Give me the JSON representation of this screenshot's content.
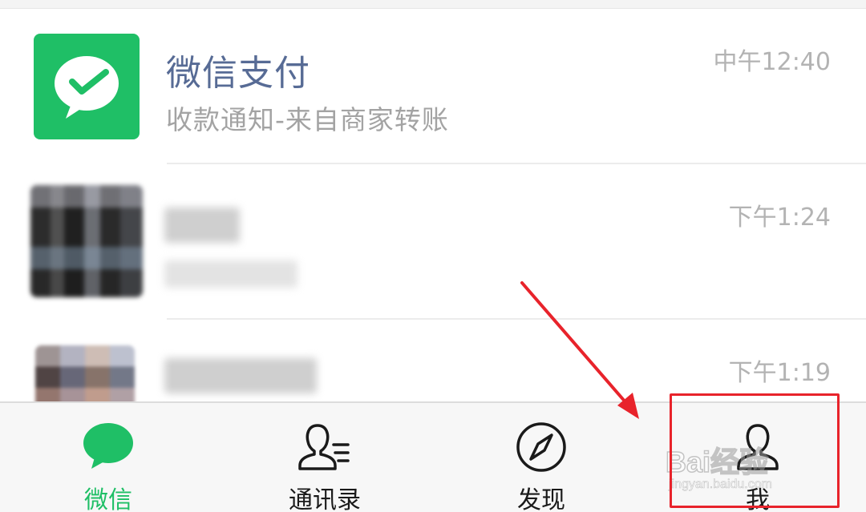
{
  "chats": [
    {
      "name": "微信支付",
      "preview": "收款通知-来自商家转账",
      "time": "中午12:40",
      "avatar": "wechat-pay-logo"
    },
    {
      "name": "",
      "preview": "",
      "time": "下午1:24",
      "avatar": "blurred-photo"
    },
    {
      "name": "",
      "preview": "",
      "time": "下午1:19",
      "avatar": "blurred-collage"
    }
  ],
  "tabs": [
    {
      "label": "微信",
      "icon": "chat-bubble-icon",
      "active": true
    },
    {
      "label": "通讯录",
      "icon": "contacts-icon",
      "active": false
    },
    {
      "label": "发现",
      "icon": "compass-icon",
      "active": false
    },
    {
      "label": "我",
      "icon": "person-icon",
      "active": false
    }
  ],
  "watermark": {
    "brand": "Bai经验",
    "url": "jingyan.baidu.com"
  },
  "colors": {
    "brand_green": "#1fbf66",
    "name_blue": "#576b95",
    "annotation_red": "#e8232b"
  }
}
